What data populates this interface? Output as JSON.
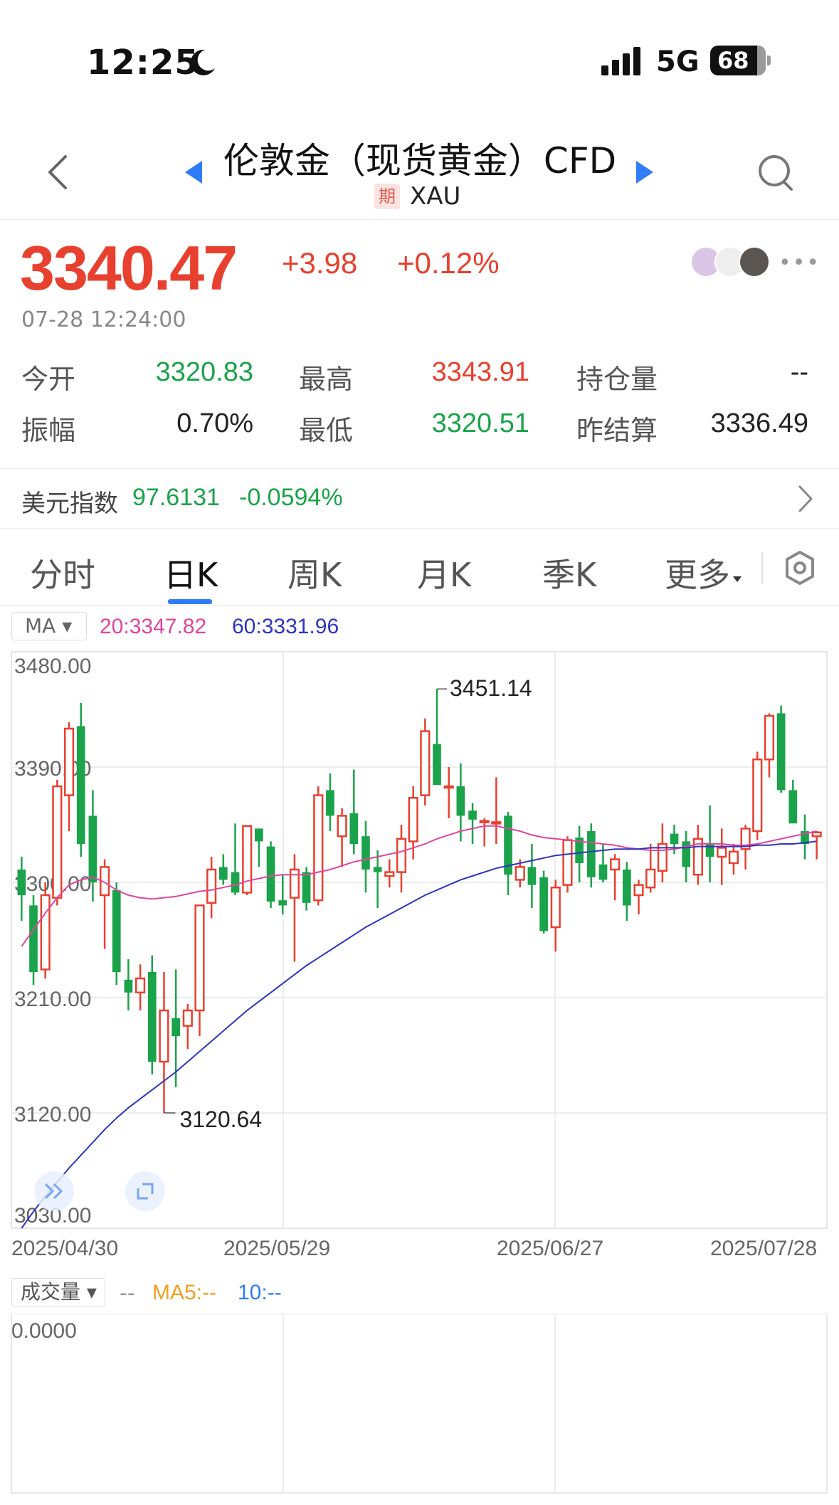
{
  "status_bar": {
    "time": "12:25",
    "network": "5G",
    "battery": "68"
  },
  "header": {
    "title": "伦敦金（现货黄金）CFD",
    "badge": "期",
    "code": "XAU"
  },
  "quote": {
    "price": "3340.47",
    "change": "+3.98",
    "change_pct": "+0.12%",
    "timestamp": "07-28 12:24:00"
  },
  "stats": [
    {
      "label": "今开",
      "value": "3320.83",
      "color": "green"
    },
    {
      "label": "最高",
      "value": "3343.91",
      "color": "red"
    },
    {
      "label": "持仓量",
      "value": "--",
      "color": "dark"
    },
    {
      "label": "振幅",
      "value": "0.70%",
      "color": "dark"
    },
    {
      "label": "最低",
      "value": "3320.51",
      "color": "green"
    },
    {
      "label": "昨结算",
      "value": "3336.49",
      "color": "dark"
    }
  ],
  "usd_index": {
    "label": "美元指数",
    "value": "97.6131",
    "change_pct": "-0.0594%"
  },
  "tabs": [
    "分时",
    "日K",
    "周K",
    "月K",
    "季K",
    "更多"
  ],
  "active_tab": "日K",
  "ma_bar": {
    "selector": "MA",
    "ma20": "20:3347.82",
    "ma60": "60:3331.96"
  },
  "volume_bar": {
    "selector": "成交量",
    "value": "--",
    "ma5": "MA5:--",
    "ma10": "10:--",
    "axis_label": "0.0000"
  },
  "colors": {
    "up": "#e8402f",
    "down": "#1aa34a",
    "ma20": "#e0469c",
    "ma60": "#2e35c0",
    "accent": "#2f7cf6"
  },
  "chart_data": {
    "type": "candlestick",
    "y_ticks": [
      "3480.00",
      "3390.00",
      "3300.00",
      "3210.00",
      "3120.00",
      "3030.00"
    ],
    "ylim": [
      3030,
      3480
    ],
    "x_ticks": [
      "2025/04/30",
      "2025/05/29",
      "2025/06/27",
      "2025/07/28"
    ],
    "annotations": {
      "high": "3451.14",
      "low": "3120.64"
    },
    "candles": [
      [
        3310,
        3320,
        3270,
        3290
      ],
      [
        3282,
        3290,
        3220,
        3230
      ],
      [
        3232,
        3300,
        3225,
        3290
      ],
      [
        3288,
        3380,
        3282,
        3375
      ],
      [
        3368,
        3425,
        3340,
        3420
      ],
      [
        3422,
        3440,
        3320,
        3330
      ],
      [
        3352,
        3372,
        3285,
        3300
      ],
      [
        3290,
        3318,
        3248,
        3312
      ],
      [
        3294,
        3300,
        3220,
        3230
      ],
      [
        3224,
        3240,
        3200,
        3214
      ],
      [
        3214,
        3236,
        3200,
        3225
      ],
      [
        3230,
        3243,
        3150,
        3160
      ],
      [
        3160,
        3230,
        3120,
        3200
      ],
      [
        3194,
        3232,
        3140,
        3180
      ],
      [
        3188,
        3205,
        3170,
        3200
      ],
      [
        3200,
        3282,
        3180,
        3282
      ],
      [
        3284,
        3320,
        3272,
        3310
      ],
      [
        3312,
        3322,
        3298,
        3302
      ],
      [
        3308,
        3346,
        3290,
        3292
      ],
      [
        3292,
        3344,
        3290,
        3344
      ],
      [
        3342,
        3342,
        3312,
        3332
      ],
      [
        3328,
        3332,
        3280,
        3285
      ],
      [
        3286,
        3306,
        3275,
        3282
      ],
      [
        3288,
        3322,
        3238,
        3310
      ],
      [
        3308,
        3312,
        3278,
        3284
      ],
      [
        3286,
        3375,
        3282,
        3368
      ],
      [
        3372,
        3385,
        3340,
        3352
      ],
      [
        3336,
        3358,
        3312,
        3352
      ],
      [
        3354,
        3388,
        3322,
        3330
      ],
      [
        3336,
        3348,
        3292,
        3310
      ],
      [
        3312,
        3325,
        3280,
        3308
      ],
      [
        3305,
        3318,
        3296,
        3308
      ],
      [
        3308,
        3345,
        3292,
        3334
      ],
      [
        3332,
        3375,
        3318,
        3366
      ],
      [
        3368,
        3428,
        3360,
        3418
      ],
      [
        3408,
        3451,
        3400,
        3376
      ],
      [
        3375,
        3390,
        3350,
        3375
      ],
      [
        3375,
        3393,
        3332,
        3352
      ],
      [
        3356,
        3362,
        3330,
        3349
      ],
      [
        3347,
        3350,
        3328,
        3348
      ],
      [
        3347,
        3382,
        3330,
        3347
      ],
      [
        3352,
        3355,
        3290,
        3306
      ],
      [
        3302,
        3318,
        3296,
        3312
      ],
      [
        3312,
        3330,
        3280,
        3298
      ],
      [
        3304,
        3309,
        3260,
        3262
      ],
      [
        3265,
        3302,
        3246,
        3296
      ],
      [
        3298,
        3336,
        3292,
        3333
      ],
      [
        3335,
        3344,
        3300,
        3315
      ],
      [
        3340,
        3346,
        3296,
        3304
      ],
      [
        3314,
        3330,
        3300,
        3302
      ],
      [
        3310,
        3322,
        3286,
        3318
      ],
      [
        3310,
        3316,
        3270,
        3282
      ],
      [
        3290,
        3302,
        3275,
        3298
      ],
      [
        3296,
        3330,
        3292,
        3310
      ],
      [
        3309,
        3346,
        3300,
        3330
      ],
      [
        3338,
        3345,
        3322,
        3330
      ],
      [
        3332,
        3340,
        3300,
        3312
      ],
      [
        3306,
        3345,
        3298,
        3334
      ],
      [
        3330,
        3360,
        3300,
        3320
      ],
      [
        3320,
        3342,
        3298,
        3327
      ],
      [
        3315,
        3330,
        3306,
        3324
      ],
      [
        3326,
        3345,
        3310,
        3342
      ],
      [
        3340,
        3402,
        3333,
        3396
      ],
      [
        3396,
        3432,
        3382,
        3430
      ],
      [
        3432,
        3438,
        3370,
        3372
      ],
      [
        3372,
        3380,
        3355,
        3346
      ],
      [
        3340,
        3353,
        3318,
        3330
      ],
      [
        3336,
        3340,
        3318,
        3339
      ]
    ],
    "ma20": [
      3250,
      3263,
      3276,
      3288,
      3298,
      3302,
      3304,
      3300,
      3294,
      3290,
      3288,
      3287,
      3288,
      3289,
      3291,
      3293,
      3294,
      3296,
      3298,
      3301,
      3303,
      3305,
      3306,
      3306,
      3306,
      3308,
      3310,
      3313,
      3316,
      3318,
      3320,
      3322,
      3324,
      3327,
      3330,
      3334,
      3337,
      3340,
      3342,
      3344,
      3344,
      3342,
      3340,
      3337,
      3335,
      3334,
      3333,
      3332,
      3331,
      3330,
      3329,
      3327,
      3326,
      3325,
      3325,
      3326,
      3328,
      3330,
      3330,
      3330,
      3329,
      3329,
      3330,
      3332,
      3334,
      3336,
      3338,
      3340
    ],
    "ma60": [
      3030,
      3043,
      3055,
      3066,
      3077,
      3087,
      3097,
      3107,
      3116,
      3124,
      3131,
      3138,
      3145,
      3152,
      3160,
      3168,
      3176,
      3184,
      3192,
      3200,
      3207,
      3214,
      3221,
      3228,
      3235,
      3241,
      3247,
      3253,
      3259,
      3265,
      3270,
      3275,
      3280,
      3285,
      3290,
      3294,
      3298,
      3302,
      3305,
      3308,
      3311,
      3313,
      3315,
      3317,
      3319,
      3321,
      3322,
      3323,
      3324,
      3325,
      3326,
      3326,
      3326,
      3327,
      3327,
      3327,
      3327,
      3328,
      3328,
      3328,
      3328,
      3328,
      3329,
      3329,
      3330,
      3330,
      3331,
      3332
    ]
  }
}
